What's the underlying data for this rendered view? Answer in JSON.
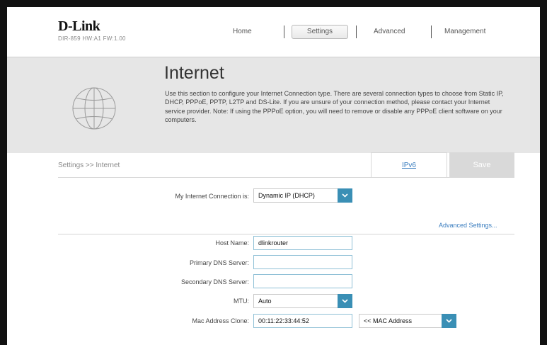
{
  "header": {
    "brand": "D-Link",
    "model_line": "DIR-859   HW:A1   FW:1.00",
    "nav": {
      "home": "Home",
      "settings": "Settings",
      "advanced": "Advanced",
      "management": "Management"
    },
    "active_tab": "Settings"
  },
  "banner": {
    "title": "Internet",
    "description": "Use this section to configure your Internet Connection type. There are several connection types to choose from Static IP, DHCP, PPPoE, PPTP, L2TP and DS-Lite. If you are unsure of your connection method, please contact your Internet service provider. Note: If using the PPPoE option, you will need to remove or disable any PPPoE client software on your computers.",
    "icon": "globe-icon"
  },
  "toolbar": {
    "breadcrumb": "Settings >> Internet",
    "ipv6_label": "IPv6",
    "save_label": "Save"
  },
  "connection": {
    "label": "My Internet Connection is:",
    "value": "Dynamic IP (DHCP)"
  },
  "advanced_link": "Advanced Settings...",
  "form": {
    "host_name_label": "Host Name:",
    "host_name_value": "dlinkrouter",
    "primary_dns_label": "Primary DNS Server:",
    "primary_dns_value": "",
    "secondary_dns_label": "Secondary DNS Server:",
    "secondary_dns_value": "",
    "mtu_label": "MTU:",
    "mtu_value": "Auto",
    "mac_label": "Mac Address Clone:",
    "mac_value": "00:11:22:33:44:52",
    "mac_select_value": "<< MAC Address"
  },
  "colors": {
    "accent": "#3a8fb5",
    "link": "#3a7dbf",
    "banner_bg": "#e6e6e6",
    "save_bg": "#d9d9d9"
  }
}
